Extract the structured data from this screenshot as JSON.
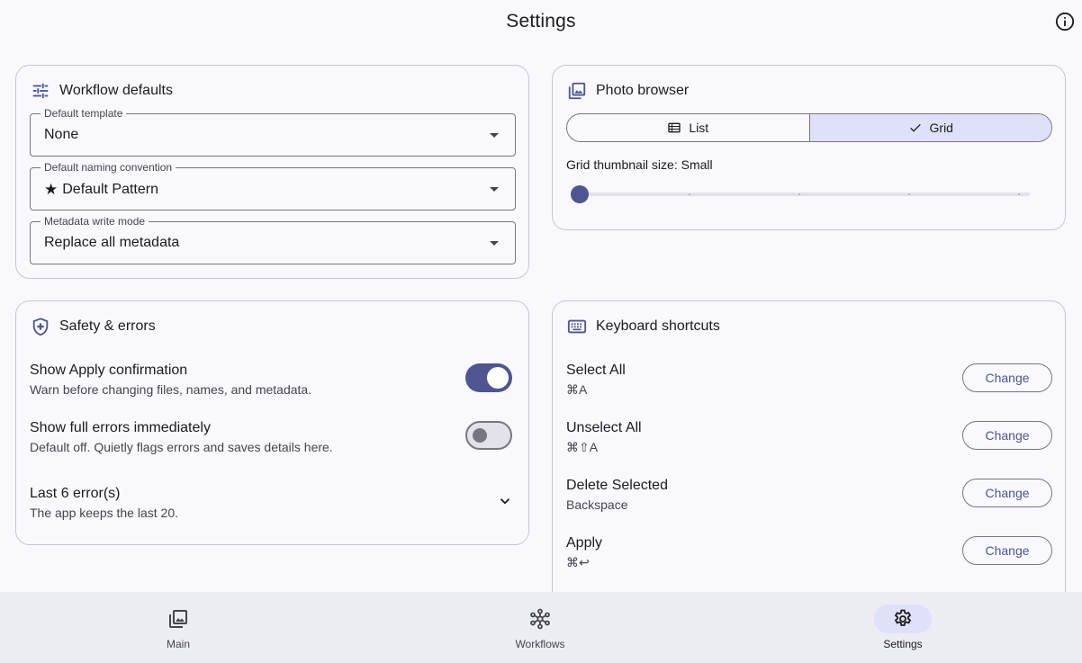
{
  "header": {
    "title": "Settings",
    "info_icon": "info-icon"
  },
  "workflow_defaults": {
    "title": "Workflow defaults",
    "icon": "tune-icon",
    "fields": [
      {
        "label": "Default template",
        "value": "None",
        "icon": ""
      },
      {
        "label": "Default naming convention",
        "value": "Default Pattern",
        "icon": "★"
      },
      {
        "label": "Metadata write mode",
        "value": "Replace all metadata",
        "icon": ""
      }
    ]
  },
  "photo_browser": {
    "title": "Photo browser",
    "icon": "photo-library-icon",
    "view_options": [
      {
        "label": "List",
        "icon": "list-icon",
        "selected": false
      },
      {
        "label": "Grid",
        "icon": "check-icon",
        "selected": true
      }
    ],
    "slider": {
      "label": "Grid thumbnail size: Small",
      "level_fraction": 0.0
    }
  },
  "safety": {
    "title": "Safety & errors",
    "icon": "shield-icon",
    "rows": [
      {
        "title": "Show Apply confirmation",
        "subtitle": "Warn before changing files, names, and metadata.",
        "toggle": true
      },
      {
        "title": "Show full errors immediately",
        "subtitle": "Default off. Quietly flags errors and saves details here.",
        "toggle": false
      }
    ],
    "errors": {
      "title": "Last 6 error(s)",
      "subtitle": "The app keeps the last 20."
    }
  },
  "shortcuts": {
    "title": "Keyboard shortcuts",
    "icon": "keyboard-icon",
    "button_label": "Change",
    "items": [
      {
        "name": "Select All",
        "keys": "⌘A"
      },
      {
        "name": "Unselect All",
        "keys": "⌘⇧A"
      },
      {
        "name": "Delete Selected",
        "keys": "Backspace"
      },
      {
        "name": "Apply",
        "keys": "⌘↩"
      }
    ]
  },
  "nav": {
    "items": [
      {
        "label": "Main",
        "icon": "photo-icon",
        "active": false
      },
      {
        "label": "Workflows",
        "icon": "workflow-icon",
        "active": false
      },
      {
        "label": "Settings",
        "icon": "gear-icon",
        "active": true
      }
    ]
  },
  "colors": {
    "accent": "#4e5590",
    "accent_container": "#dfe0fa",
    "outline": "#79767f",
    "background": "#f8f8fd"
  }
}
